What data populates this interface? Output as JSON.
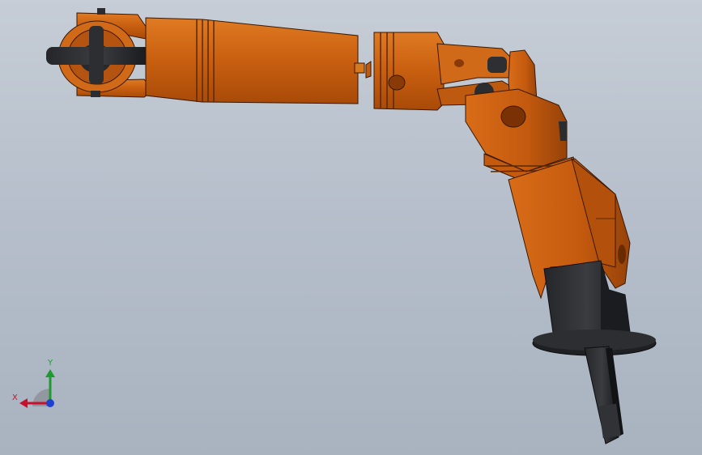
{
  "view": {
    "background_top": "#c6cdd6",
    "background_bottom": "#a9b3c0",
    "model_color": "#c86214",
    "model_dark": "#8a3c06",
    "shaft_color": "#2e3035"
  },
  "triad": {
    "x_label": "X",
    "y_label": "Y",
    "x_color": "#c8102e",
    "y_color": "#1f9a31",
    "z_color": "#1f3fd0"
  }
}
